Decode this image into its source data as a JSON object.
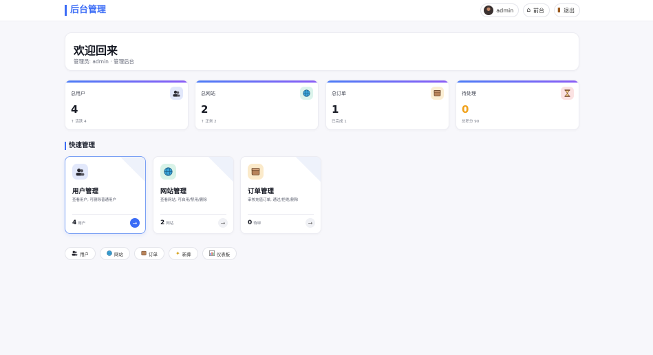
{
  "header": {
    "brand": "后台管理",
    "user": {
      "name": "admin",
      "icon": "avatar"
    },
    "front_button": {
      "icon": "home-icon",
      "label": "前台"
    },
    "logout_button": {
      "icon": "door-icon",
      "label": "退出"
    }
  },
  "welcome": {
    "title": "欢迎回来",
    "subtitle": "管理员: admin · 管理后台"
  },
  "stats": [
    {
      "label": "总用户",
      "value": "4",
      "note": "↑ 活跃 4",
      "icon": "users-icon",
      "badge_color": "#e2e8fb"
    },
    {
      "label": "总网站",
      "value": "2",
      "note": "↑ 正常 2",
      "icon": "globe-icon",
      "badge_color": "#dcf4ec"
    },
    {
      "label": "总订单",
      "value": "1",
      "note": "已完成 1",
      "icon": "box-icon",
      "badge_color": "#fbeed3"
    },
    {
      "label": "待处理",
      "value": "0",
      "note": "总积分 90",
      "icon": "hourglass-icon",
      "badge_color": "#fbe2e2",
      "value_color": "#f0a11b"
    }
  ],
  "quick": {
    "title": "快速管理",
    "cards": [
      {
        "title": "用户管理",
        "desc": "查看用户, 可删除普通用户",
        "count": "4",
        "unit": "用户",
        "icon": "users-icon",
        "badge_color": "#e2e8fb"
      },
      {
        "title": "网站管理",
        "desc": "查看网站, 可启用/禁用/删除",
        "count": "2",
        "unit": "网站",
        "icon": "globe-icon",
        "badge_color": "#d9f3e8"
      },
      {
        "title": "订单管理",
        "desc": "审核充值订单, 通过/拒绝/删除",
        "count": "0",
        "unit": "待审",
        "icon": "box-icon",
        "badge_color": "#fbeaca"
      }
    ]
  },
  "chips": [
    {
      "label": "用户",
      "icon": "users-icon"
    },
    {
      "label": "网站",
      "icon": "globe-icon"
    },
    {
      "label": "订单",
      "icon": "box-icon"
    },
    {
      "label": "新葬",
      "icon": "sparkle-icon"
    },
    {
      "label": "仪表板",
      "icon": "chart-icon"
    }
  ]
}
